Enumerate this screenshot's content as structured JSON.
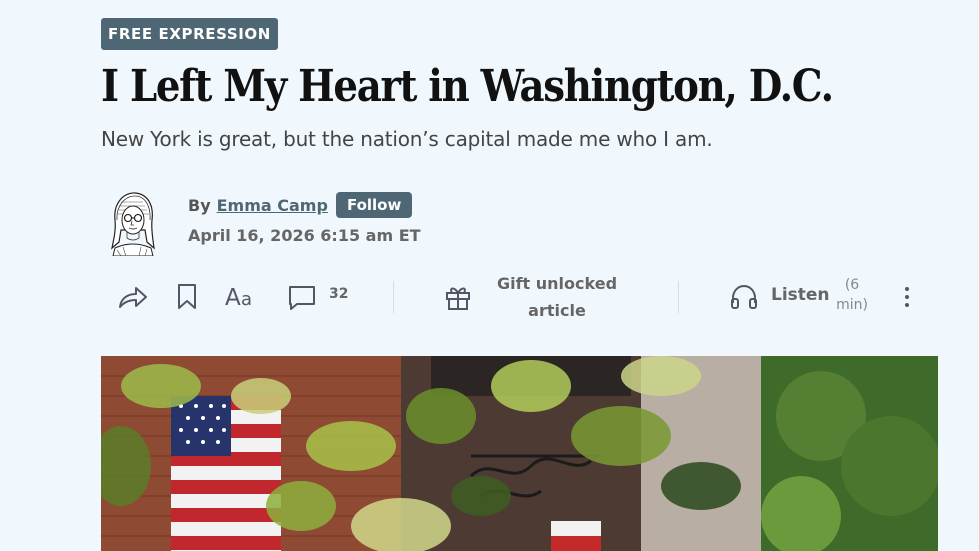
{
  "article": {
    "category": "FREE EXPRESSION",
    "headline": "I Left My Heart in Washington, D.C.",
    "dek": "New York is great, but the nation’s capital made me who I am."
  },
  "byline": {
    "prefix": "By",
    "author": "Emma Camp",
    "follow_label": "Follow",
    "date": "April 16, 2026 6:15 am ET"
  },
  "toolbar": {
    "icons": [
      "share-icon",
      "bookmark-icon",
      "text-size-icon",
      "comment-icon",
      "gift-icon",
      "headphones-icon",
      "more-icon"
    ],
    "comment_count": "32",
    "gift_label": "Gift unlocked article",
    "listen_label": "Listen",
    "listen_duration": "(6 min)"
  },
  "hero_image": {
    "description_icon": "photo-street-flags"
  }
}
